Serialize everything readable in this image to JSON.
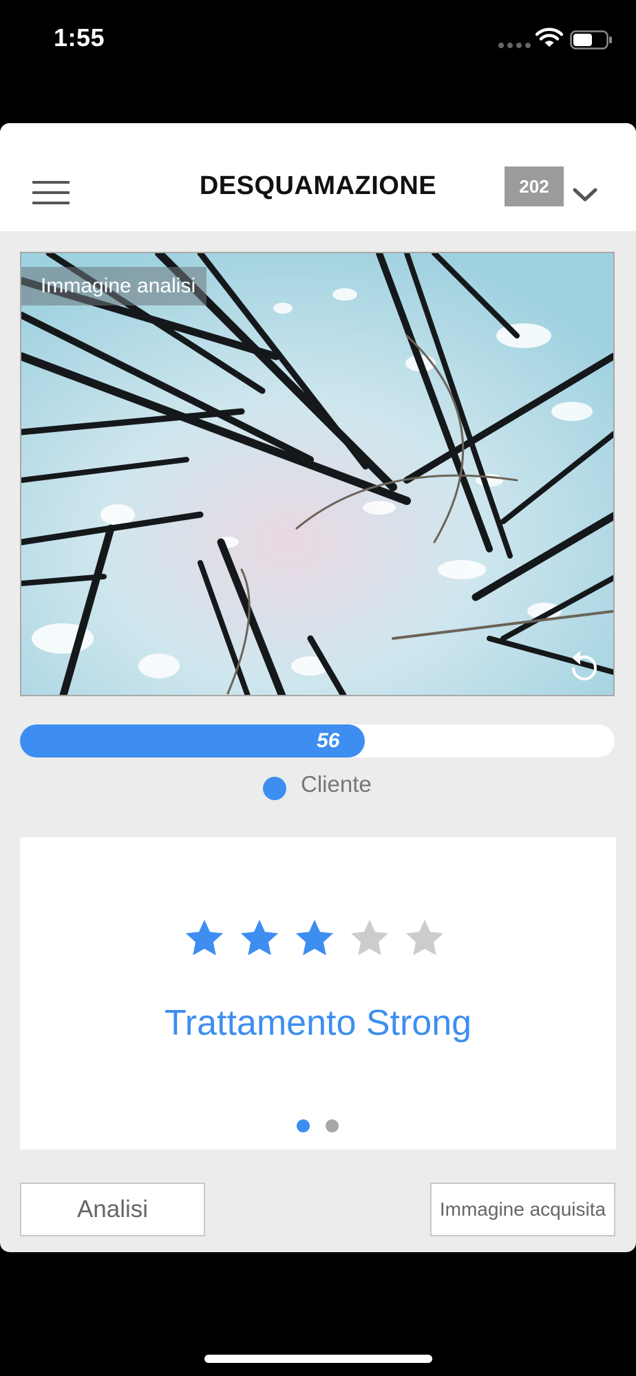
{
  "status_bar": {
    "time": "1:55",
    "icons": [
      "cellular-signal-icon",
      "wifi-icon",
      "battery-icon"
    ]
  },
  "header": {
    "menu_icon": "hamburger-menu-icon",
    "title": "DESQUAMAZIONE",
    "badge": "202",
    "dropdown_icon": "chevron-down-icon"
  },
  "analysis_image": {
    "label": "Immagine analisi",
    "rotate_icon": "rotate-icon"
  },
  "score": {
    "value": "56",
    "fraction": 0.58,
    "color": "#3d8ef0"
  },
  "legend": {
    "label": "Cliente",
    "color": "#3d8ef0"
  },
  "rating": {
    "stars_filled": 3,
    "stars_total": 5,
    "treatment": "Trattamento Strong",
    "active_color": "#3d8ef0",
    "inactive_color": "#cccccc"
  },
  "pager": {
    "pages": 2,
    "active": 0
  },
  "buttons": {
    "analisi": "Analisi",
    "immagine_acquisita": "Immagine acquisita"
  }
}
